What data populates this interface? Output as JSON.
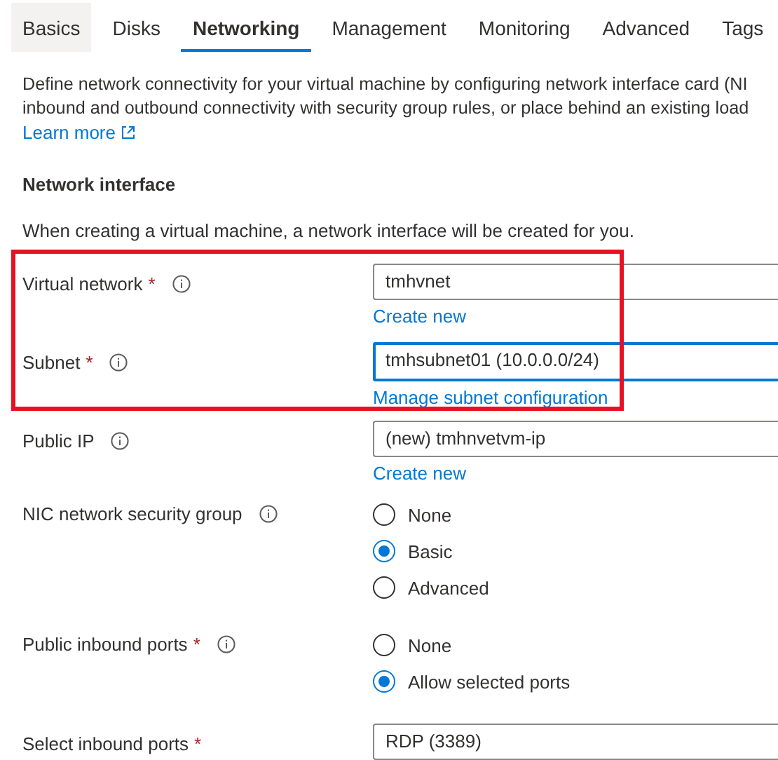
{
  "tabs": [
    {
      "label": "Basics",
      "selected": false,
      "hovered": true
    },
    {
      "label": "Disks",
      "selected": false,
      "hovered": false
    },
    {
      "label": "Networking",
      "selected": true,
      "hovered": false
    },
    {
      "label": "Management",
      "selected": false,
      "hovered": false
    },
    {
      "label": "Monitoring",
      "selected": false,
      "hovered": false
    },
    {
      "label": "Advanced",
      "selected": false,
      "hovered": false
    },
    {
      "label": "Tags",
      "selected": false,
      "hovered": false
    }
  ],
  "description": [
    "Define network connectivity for your virtual machine by configuring network interface card (NI",
    "inbound and outbound connectivity with security group rules, or place behind an existing load"
  ],
  "learn_more": "Learn more",
  "section_title": "Network interface",
  "section_note": "When creating a virtual machine, a network interface will be created for you.",
  "fields": [
    {
      "kind": "select",
      "label": "Virtual network",
      "required_mark": "*",
      "info": true,
      "value": "tmhvnet",
      "focused": false,
      "link": "Create new",
      "highlighted": true
    },
    {
      "kind": "select",
      "label": "Subnet",
      "required_mark": "*",
      "info": true,
      "value": "tmhsubnet01 (10.0.0.0/24)",
      "focused": true,
      "link": "Manage subnet configuration",
      "highlighted": true
    },
    {
      "kind": "select",
      "label": "Public IP",
      "info": true,
      "value": "(new) tmhnvetvm-ip",
      "focused": false,
      "link": "Create new"
    },
    {
      "kind": "radio",
      "label": "NIC network security group",
      "info": true,
      "options": [
        {
          "label": "None",
          "selected": false
        },
        {
          "label": "Basic",
          "selected": true
        },
        {
          "label": "Advanced",
          "selected": false
        }
      ]
    },
    {
      "kind": "radio",
      "label": "Public inbound ports",
      "required_mark": "*",
      "info": true,
      "options": [
        {
          "label": "None",
          "selected": false
        },
        {
          "label": "Allow selected ports",
          "selected": true
        }
      ]
    },
    {
      "kind": "select",
      "label": "Select inbound ports",
      "required_mark": "*",
      "value": "RDP (3389)",
      "focused": false
    }
  ]
}
